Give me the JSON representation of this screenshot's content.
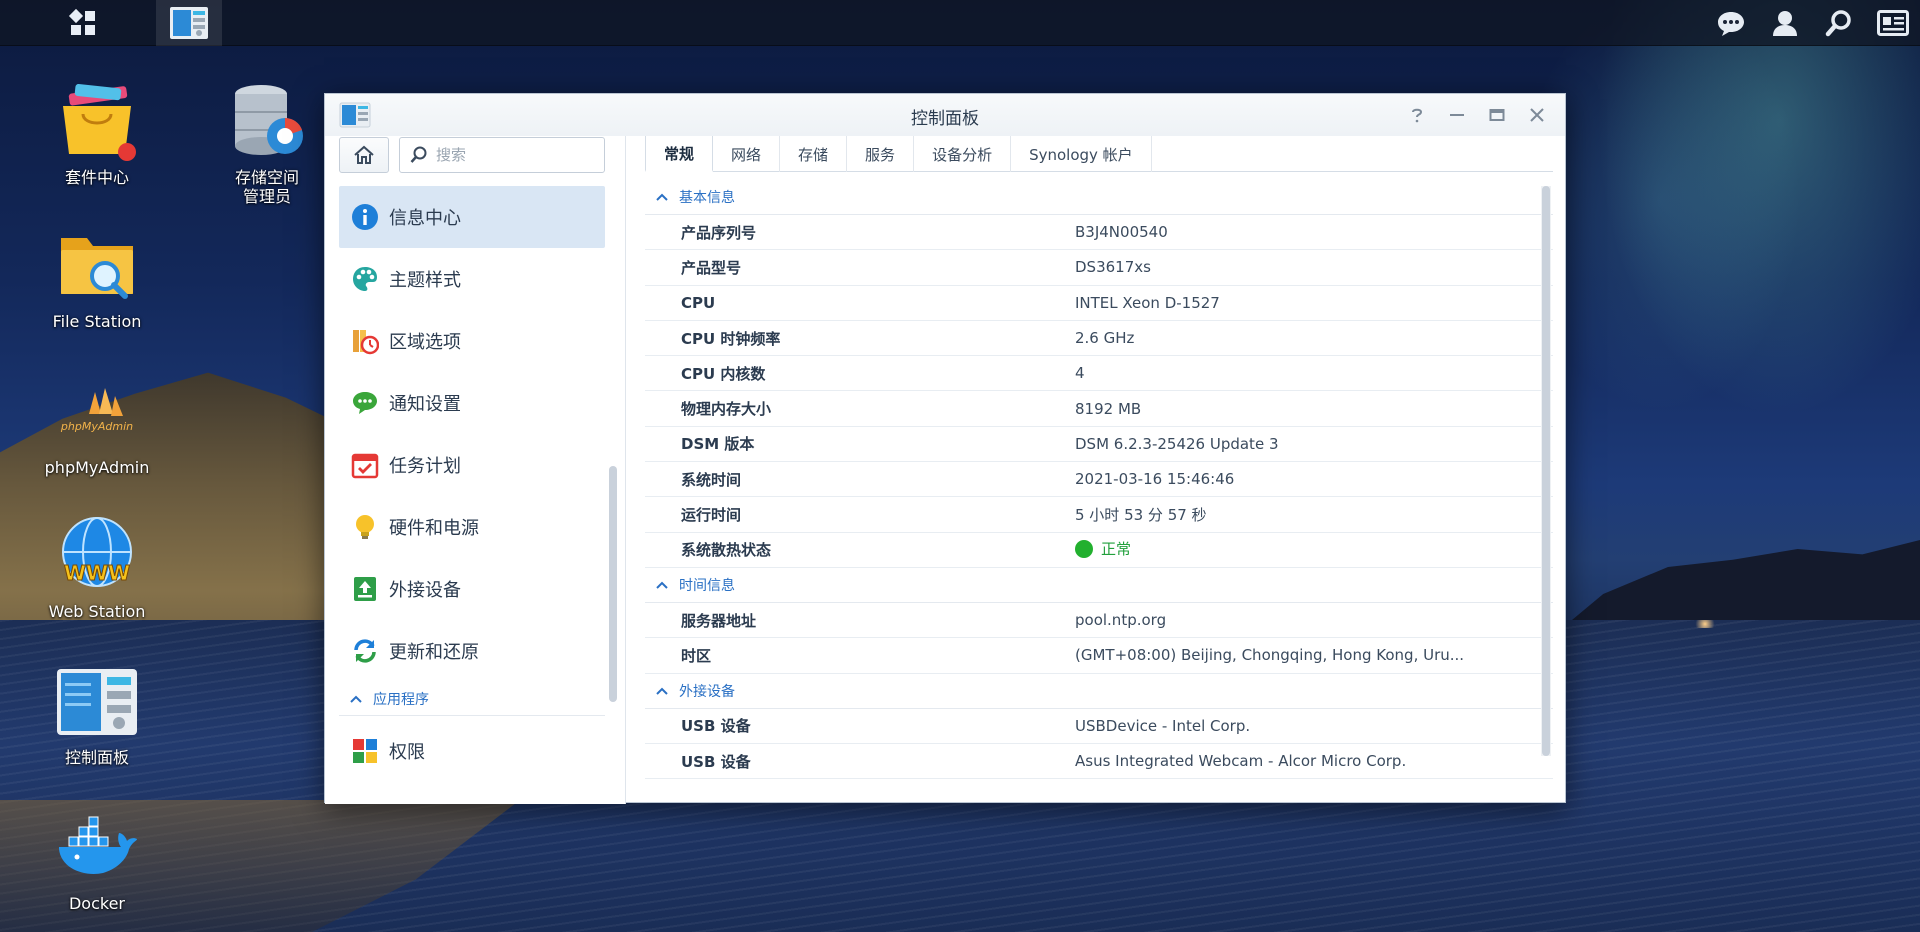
{
  "taskbar": {
    "main_menu_icon": "grid-icon",
    "open_app_icon": "control-panel-icon",
    "right_icons": [
      "chat-icon",
      "user-icon",
      "search-icon",
      "widgets-icon"
    ]
  },
  "desktop": {
    "icons": [
      {
        "label": "套件中心",
        "icon": "package-center-icon"
      },
      {
        "label": "存储空间\n管理员",
        "icon": "storage-manager-icon"
      },
      {
        "label": "File Station",
        "icon": "file-station-icon"
      },
      {
        "label": "phpMyAdmin",
        "icon": "phpmyadmin-icon"
      },
      {
        "label": "Web Station",
        "icon": "web-station-icon"
      },
      {
        "label": "控制面板",
        "icon": "control-panel-icon"
      },
      {
        "label": "Docker",
        "icon": "docker-icon"
      }
    ]
  },
  "window": {
    "title": "控制面板",
    "controls": [
      "help-icon",
      "minimize-icon",
      "maximize-icon",
      "close-icon"
    ]
  },
  "sidebar": {
    "search_placeholder": "搜索",
    "items": [
      {
        "label": "信息中心",
        "icon": "info-icon",
        "active": true
      },
      {
        "label": "主题样式",
        "icon": "palette-icon"
      },
      {
        "label": "区域选项",
        "icon": "region-clock-icon"
      },
      {
        "label": "通知设置",
        "icon": "chat-bubble-icon"
      },
      {
        "label": "任务计划",
        "icon": "calendar-check-icon"
      },
      {
        "label": "硬件和电源",
        "icon": "bulb-icon"
      },
      {
        "label": "外接设备",
        "icon": "external-device-icon"
      },
      {
        "label": "更新和还原",
        "icon": "refresh-icon"
      }
    ],
    "section_label": "应用程序",
    "section_items": [
      {
        "label": "权限",
        "icon": "privileges-icon"
      }
    ]
  },
  "tabs": [
    "常规",
    "网络",
    "存储",
    "服务",
    "设备分析",
    "Synology 帐户"
  ],
  "active_tab": "常规",
  "groups": {
    "basic": {
      "title": "基本信息",
      "rows": [
        {
          "key": "产品序列号",
          "value": "B3J4N00540"
        },
        {
          "key": "产品型号",
          "value": "DS3617xs"
        },
        {
          "key": "CPU",
          "value": "INTEL Xeon D-1527"
        },
        {
          "key": "CPU 时钟频率",
          "value": "2.6 GHz"
        },
        {
          "key": "CPU 内核数",
          "value": "4"
        },
        {
          "key": "物理内存大小",
          "value": "8192 MB"
        },
        {
          "key": "DSM 版本",
          "value": "DSM 6.2.3-25426 Update 3"
        },
        {
          "key": "系统时间",
          "value": "2021-03-16 15:46:46"
        },
        {
          "key": "运行时间",
          "value": "5 小时 53 分 57 秒"
        }
      ],
      "thermal_key": "系统散热状态",
      "thermal_value": "正常",
      "thermal_color": "#22b02e"
    },
    "time": {
      "title": "时间信息",
      "rows": [
        {
          "key": "服务器地址",
          "value": "pool.ntp.org"
        },
        {
          "key": "时区",
          "value": "(GMT+08:00) Beijing, Chongqing, Hong Kong, Uru..."
        }
      ]
    },
    "external": {
      "title": "外接设备",
      "rows": [
        {
          "key": "USB 设备",
          "value": "USBDevice - Intel Corp."
        },
        {
          "key": "USB 设备",
          "value": "Asus Integrated Webcam - Alcor Micro Corp."
        }
      ]
    }
  },
  "colors": {
    "accent_blue": "#2a70c4",
    "active_nav_bg": "#d9e6f4",
    "status_ok": "#22b02e"
  }
}
